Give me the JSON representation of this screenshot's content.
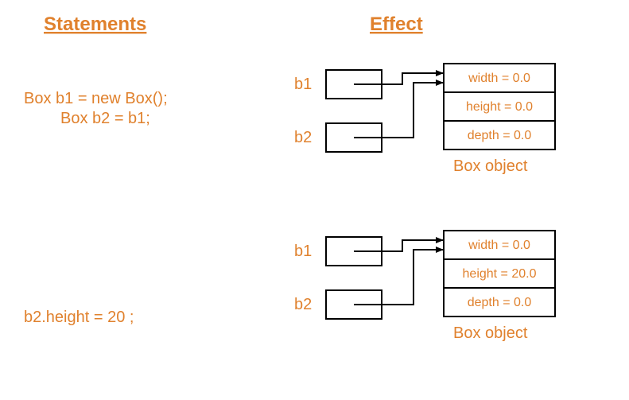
{
  "headings": {
    "statements": "Statements",
    "effect": "Effect"
  },
  "code": {
    "line1": "Box b1 = new Box();",
    "line2": "Box b2 = b1;",
    "line3": "b2.height = 20 ;"
  },
  "labels": {
    "b1": "b1",
    "b2": "b2",
    "box_object": "Box object"
  },
  "object1": {
    "width": "width = 0.0",
    "height": "height = 0.0",
    "depth": "depth = 0.0"
  },
  "object2": {
    "width": "width = 0.0",
    "height": "height = 20.0",
    "depth": "depth = 0.0"
  }
}
